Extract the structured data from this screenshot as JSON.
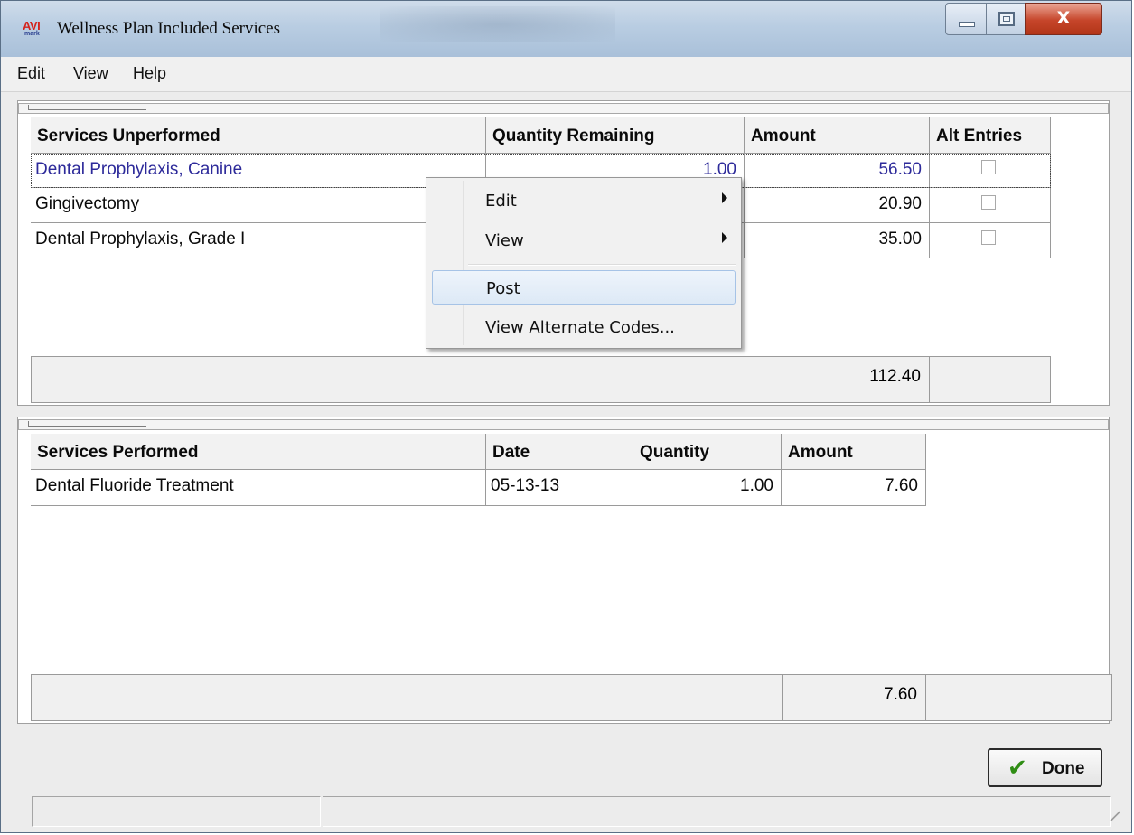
{
  "window": {
    "title": "Wellness Plan Included Services",
    "icon_text_top": "AVI",
    "icon_text_bottom": "mark",
    "close_glyph": "X"
  },
  "menubar": {
    "items": [
      "Edit",
      "View",
      "Help"
    ]
  },
  "unperformed": {
    "headers": [
      "Services Unperformed",
      "Quantity Remaining",
      "Amount",
      "Alt Entries"
    ],
    "rows": [
      {
        "service": "Dental Prophylaxis, Canine",
        "quantity": "1.00",
        "amount": "56.50",
        "alt": false
      },
      {
        "service": "Gingivectomy",
        "quantity": "",
        "amount": "20.90",
        "alt": false
      },
      {
        "service": "Dental Prophylaxis, Grade I",
        "quantity": "",
        "amount": "35.00",
        "alt": false
      }
    ],
    "total": "112.40"
  },
  "context_menu": {
    "items": [
      "Edit",
      "View",
      "Post",
      "View Alternate Codes..."
    ],
    "highlighted": "Post"
  },
  "performed": {
    "headers": [
      "Services Performed",
      "Date",
      "Quantity",
      "Amount"
    ],
    "rows": [
      {
        "service": "Dental Fluoride Treatment",
        "date": "05-13-13",
        "quantity": "1.00",
        "amount": "7.60"
      }
    ],
    "total": "7.60"
  },
  "buttons": {
    "done": "Done",
    "done_icon": "checkmark-icon"
  },
  "colors": {
    "selected_row_text": "#2d2a9a",
    "done_check": "#2f8d14",
    "close_button": "#c6452a"
  }
}
